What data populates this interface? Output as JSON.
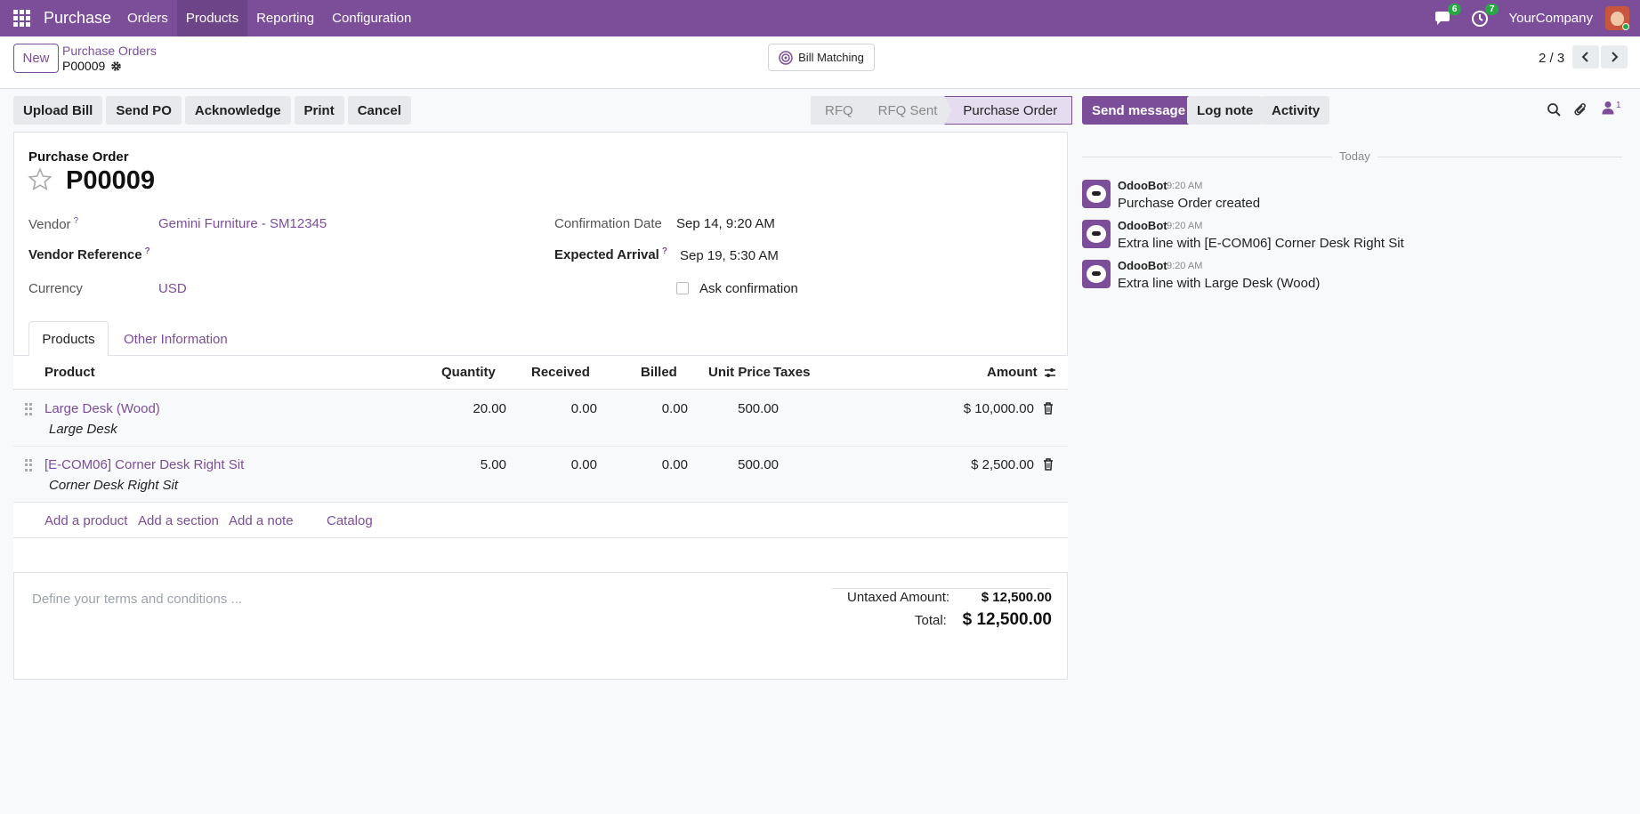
{
  "topbar": {
    "app_name": "Purchase",
    "menu": [
      "Orders",
      "Products",
      "Reporting",
      "Configuration"
    ],
    "messages_count": "6",
    "activities_count": "7",
    "company": "YourCompany"
  },
  "control_panel": {
    "new_label": "New",
    "breadcrumb_parent": "Purchase Orders",
    "breadcrumb_current": "P00009",
    "bill_matching_label": "Bill Matching",
    "pager": "2 / 3"
  },
  "statusbar": {
    "buttons": [
      "Upload Bill",
      "Send PO",
      "Acknowledge",
      "Print",
      "Cancel"
    ],
    "stages": [
      "RFQ",
      "RFQ Sent",
      "Purchase Order"
    ],
    "active_stage": "Purchase Order"
  },
  "form": {
    "doc_label": "Purchase Order",
    "doc_name": "P00009",
    "vendor_label": "Vendor",
    "vendor_value": "Gemini Furniture - SM12345",
    "vendor_ref_label": "Vendor Reference",
    "currency_label": "Currency",
    "currency_value": "USD",
    "confirmation_date_label": "Confirmation Date",
    "confirmation_date_value": "Sep 14, 9:20 AM",
    "expected_arrival_label": "Expected Arrival",
    "expected_arrival_value": "Sep 19, 5:30 AM",
    "ask_confirmation_label": "Ask confirmation",
    "help_mark": "?"
  },
  "tabs": [
    "Products",
    "Other Information"
  ],
  "lines": {
    "headers": {
      "product": "Product",
      "quantity": "Quantity",
      "received": "Received",
      "billed": "Billed",
      "unit_price": "Unit Price",
      "taxes": "Taxes",
      "amount": "Amount"
    },
    "rows": [
      {
        "product": "Large Desk (Wood)",
        "description": "Large Desk",
        "quantity": "20.00",
        "received": "0.00",
        "billed": "0.00",
        "unit_price": "500.00",
        "amount": "$ 10,000.00"
      },
      {
        "product": "[E-COM06] Corner Desk Right Sit",
        "description": "Corner Desk Right Sit",
        "quantity": "5.00",
        "received": "0.00",
        "billed": "0.00",
        "unit_price": "500.00",
        "amount": "$ 2,500.00"
      }
    ],
    "add_links": [
      "Add a product",
      "Add a section",
      "Add a note",
      "Catalog"
    ]
  },
  "footer": {
    "terms_placeholder": "Define your terms and conditions ...",
    "untaxed_label": "Untaxed Amount:",
    "untaxed_value": "$ 12,500.00",
    "total_label": "Total:",
    "total_value": "$ 12,500.00"
  },
  "chatter": {
    "send_message": "Send message",
    "log_note": "Log note",
    "activity": "Activity",
    "followers_count": "1",
    "date_separator": "Today",
    "messages": [
      {
        "author": "OdooBot",
        "time": "9:20 AM",
        "body": "Purchase Order created"
      },
      {
        "author": "OdooBot",
        "time": "9:20 AM",
        "body": "Extra line with [E-COM06] Corner Desk Right Sit"
      },
      {
        "author": "OdooBot",
        "time": "9:20 AM",
        "body": "Extra line with Large Desk (Wood)"
      }
    ]
  },
  "colors": {
    "brand": "#7c4e9a",
    "badge": "#28a745"
  }
}
